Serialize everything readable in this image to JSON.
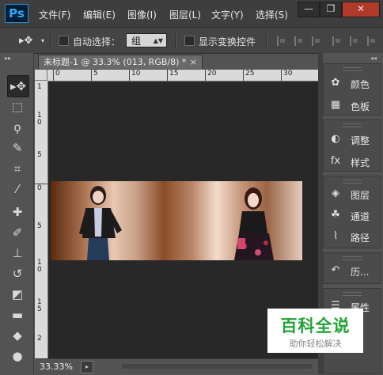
{
  "app": {
    "logo_text": "Ps"
  },
  "menu": {
    "items": [
      "文件(F)",
      "编辑(E)",
      "图像(I)",
      "图层(L)",
      "文字(Y)",
      "选择(S)"
    ]
  },
  "window_controls": {
    "minimize": "—",
    "maximize": "❐",
    "close": "✕"
  },
  "options_bar": {
    "move_tool_glyph": "▸✥",
    "auto_select_label": "自动选择：",
    "auto_select_value": "组",
    "show_transform_label": "显示变换控件"
  },
  "document": {
    "tab_title": "未标题-1 @ 33.3% (013, RGB/8) *",
    "close_glyph": "×",
    "zoom": "33.33%",
    "hruler_labels": [
      "0",
      "5",
      "10",
      "15",
      "20",
      "25",
      "30"
    ],
    "vruler_labels": [
      "0",
      "1",
      "0",
      "5",
      "1",
      "5"
    ]
  },
  "left_toolbar": {
    "collapse_glyph": "▸▸",
    "tools": [
      {
        "name": "move-tool",
        "glyph": "▸✥"
      },
      {
        "name": "marquee-tool",
        "glyph": "⬚"
      },
      {
        "name": "lasso-tool",
        "glyph": "ϙ"
      },
      {
        "name": "quick-select-tool",
        "glyph": "✎"
      },
      {
        "name": "crop-tool",
        "glyph": "⌗"
      },
      {
        "name": "eyedropper-tool",
        "glyph": "⁄"
      },
      {
        "name": "healing-brush-tool",
        "glyph": "✚"
      },
      {
        "name": "brush-tool",
        "glyph": "✐"
      },
      {
        "name": "clone-stamp-tool",
        "glyph": "⊥"
      },
      {
        "name": "history-brush-tool",
        "glyph": "↺"
      },
      {
        "name": "eraser-tool",
        "glyph": "◩"
      },
      {
        "name": "gradient-tool",
        "glyph": "▬"
      },
      {
        "name": "blur-tool",
        "glyph": "◆"
      },
      {
        "name": "dodge-tool",
        "glyph": "●"
      }
    ]
  },
  "right_panel": {
    "collapse_glyph": "◂◂",
    "groups": [
      [
        {
          "icon": "palette-icon",
          "glyph": "✿",
          "label": "颜色"
        },
        {
          "icon": "swatches-icon",
          "glyph": "▦",
          "label": "色板"
        }
      ],
      [
        {
          "icon": "adjustments-icon",
          "glyph": "◐",
          "label": "调整"
        },
        {
          "icon": "styles-icon",
          "glyph": "fx",
          "label": "样式"
        }
      ],
      [
        {
          "icon": "layers-icon",
          "glyph": "◈",
          "label": "图层"
        },
        {
          "icon": "channels-icon",
          "glyph": "☘",
          "label": "通道"
        },
        {
          "icon": "paths-icon",
          "glyph": "⌇",
          "label": "路径"
        }
      ],
      [
        {
          "icon": "history-icon",
          "glyph": "↶",
          "label": "历..."
        }
      ],
      [
        {
          "icon": "properties-icon",
          "glyph": "☰",
          "label": "属性"
        }
      ]
    ]
  },
  "watermark": {
    "title": "百科全说",
    "subtitle": "助你轻松解决"
  },
  "colors": {
    "accent": "#31a8ff",
    "watermark_green": "#21a336",
    "ui_dark": "#3e3e3e"
  }
}
